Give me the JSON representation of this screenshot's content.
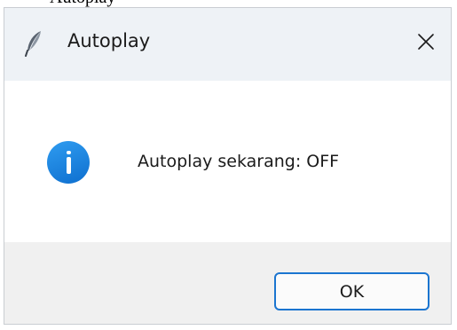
{
  "window": {
    "title": "Autoplay",
    "app_icon": "feather-icon",
    "close_icon": "close-icon",
    "clipped_title_above": "Autoplay"
  },
  "message": {
    "icon": "info-icon",
    "text": "Autoplay sekarang: OFF"
  },
  "footer": {
    "ok_label": "OK"
  },
  "colors": {
    "titlebar_bg": "#eef2f6",
    "footer_bg": "#f0f0f0",
    "accent": "#1b75d0",
    "info_icon": "#0e6fcf"
  }
}
